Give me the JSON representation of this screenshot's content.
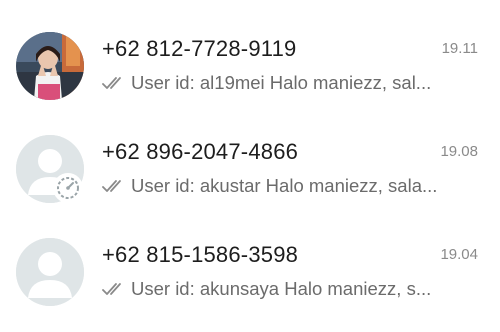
{
  "chats": [
    {
      "name": "+62 812-7728-9119",
      "time": "19.11",
      "preview": "User id: al19mei  Halo maniezz, sal...",
      "avatar": "photo-avatar"
    },
    {
      "name": "+62 896-2047-4866",
      "time": "19.08",
      "preview": "User id: akustar  Halo maniezz, sala...",
      "avatar": "default-avatar-with-timer"
    },
    {
      "name": "+62 815-1586-3598",
      "time": "19.04",
      "preview": "User id: akunsaya  Halo maniezz, s...",
      "avatar": "default-avatar"
    }
  ],
  "colors": {
    "name_text": "#1d1d1d",
    "preview_text": "#6b6b6b",
    "time_text": "#8a8a8a",
    "tick_color": "#8a8a8a",
    "default_avatar_bg": "#dfe5e7"
  }
}
